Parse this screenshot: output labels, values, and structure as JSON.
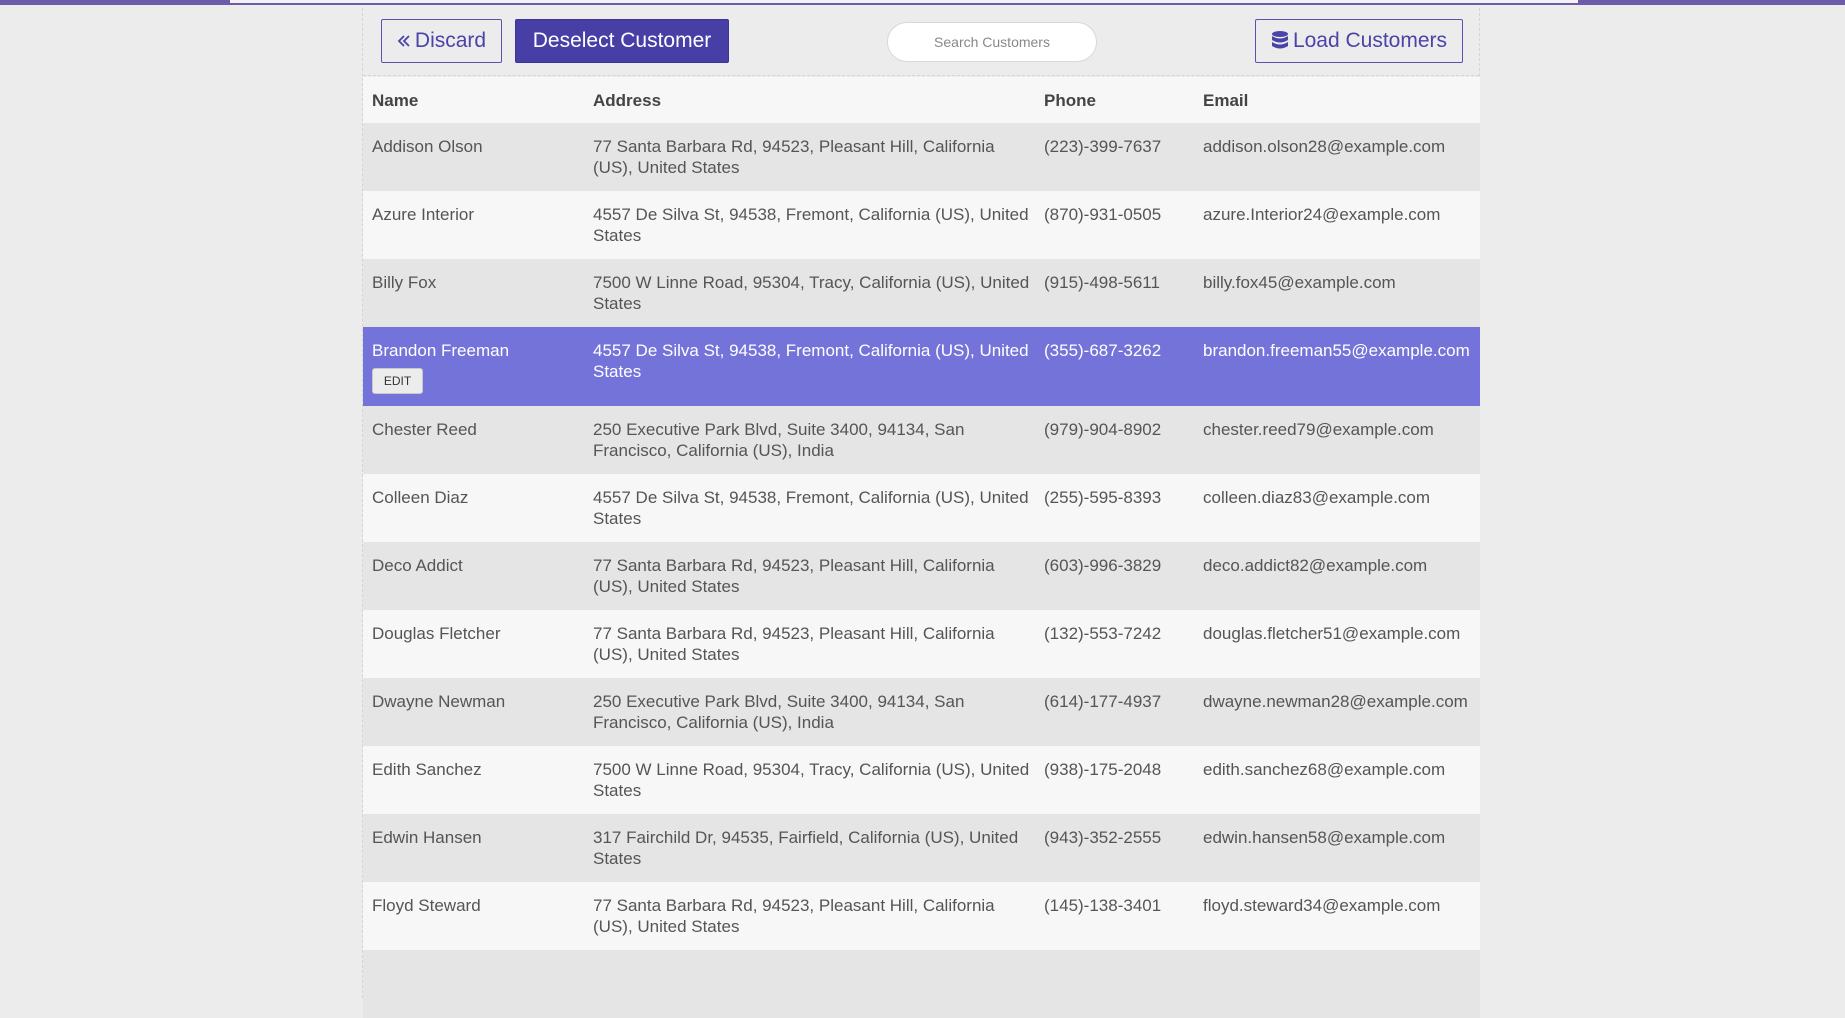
{
  "toolbar": {
    "discard_label": "Discard",
    "deselect_label": "Deselect Customer",
    "search_placeholder": "Search Customers",
    "load_label": "Load Customers"
  },
  "table": {
    "headers": {
      "name": "Name",
      "address": "Address",
      "phone": "Phone",
      "email": "Email"
    },
    "edit_label": "EDIT",
    "rows": [
      {
        "name": "Addison Olson",
        "address": "77 Santa Barbara Rd, 94523, Pleasant Hill, California (US), United States",
        "phone": "(223)-399-7637",
        "email": "addison.olson28@example.com"
      },
      {
        "name": "Azure Interior",
        "address": "4557 De Silva St, 94538, Fremont, California (US), United States",
        "phone": "(870)-931-0505",
        "email": "azure.Interior24@example.com"
      },
      {
        "name": "Billy Fox",
        "address": "7500 W Linne Road, 95304, Tracy, California (US), United States",
        "phone": "(915)-498-5611",
        "email": "billy.fox45@example.com"
      },
      {
        "name": "Brandon Freeman",
        "address": "4557 De Silva St, 94538, Fremont, California (US), United States",
        "phone": "(355)-687-3262",
        "email": "brandon.freeman55@example.com"
      },
      {
        "name": "Chester Reed",
        "address": "250 Executive Park Blvd, Suite 3400, 94134, San Francisco, California (US), India",
        "phone": "(979)-904-8902",
        "email": "chester.reed79@example.com"
      },
      {
        "name": "Colleen Diaz",
        "address": "4557 De Silva St, 94538, Fremont, California (US), United States",
        "phone": "(255)-595-8393",
        "email": "colleen.diaz83@example.com"
      },
      {
        "name": "Deco Addict",
        "address": "77 Santa Barbara Rd, 94523, Pleasant Hill, California (US), United States",
        "phone": "(603)-996-3829",
        "email": "deco.addict82@example.com"
      },
      {
        "name": "Douglas Fletcher",
        "address": "77 Santa Barbara Rd, 94523, Pleasant Hill, California (US), United States",
        "phone": "(132)-553-7242",
        "email": "douglas.fletcher51@example.com"
      },
      {
        "name": "Dwayne Newman",
        "address": "250 Executive Park Blvd, Suite 3400, 94134, San Francisco, California (US), India",
        "phone": "(614)-177-4937",
        "email": "dwayne.newman28@example.com"
      },
      {
        "name": "Edith Sanchez",
        "address": "7500 W Linne Road, 95304, Tracy, California (US), United States",
        "phone": "(938)-175-2048",
        "email": "edith.sanchez68@example.com"
      },
      {
        "name": "Edwin Hansen",
        "address": "317 Fairchild Dr, 94535, Fairfield, California (US), United States",
        "phone": "(943)-352-2555",
        "email": "edwin.hansen58@example.com"
      },
      {
        "name": "Floyd Steward",
        "address": "77 Santa Barbara Rd, 94523, Pleasant Hill, California (US), United States",
        "phone": "(145)-138-3401",
        "email": "floyd.steward34@example.com"
      }
    ]
  },
  "colors": {
    "accent": "#473fa6",
    "selected_row": "#7373d9",
    "top_bar": "#6d5aa8"
  },
  "icons": {
    "discard": "double-chevron-left-icon",
    "load": "database-icon"
  }
}
